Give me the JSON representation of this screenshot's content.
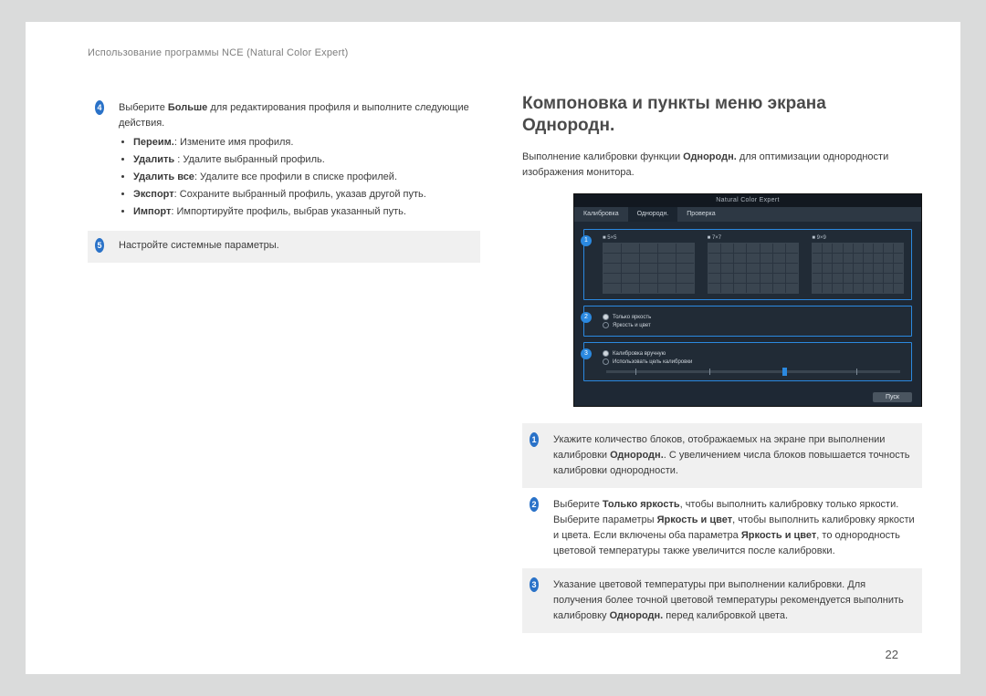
{
  "chapter": "Использование программы NCE (Natural Color Expert)",
  "pageNumber": "22",
  "left": {
    "row4": {
      "num": "4",
      "intro_a": "Выберите ",
      "intro_bold": "Больше",
      "intro_b": " для редактирования профиля и выполните следующие действия.",
      "items": [
        {
          "b": "Переим.",
          "t": ": Измените имя профиля."
        },
        {
          "b": "Удалить ",
          "t": ": Удалите выбранный профиль."
        },
        {
          "b": "Удалить все",
          "t": ": Удалите все профили в списке профилей."
        },
        {
          "b": "Экспорт",
          "t": ": Сохраните выбранный профиль, указав другой путь."
        },
        {
          "b": "Импорт",
          "t": ": Импортируйте профиль, выбрав указанный путь."
        }
      ]
    },
    "row5": {
      "num": "5",
      "text": "Настройте системные параметры."
    }
  },
  "right": {
    "title": "Компоновка и пункты меню экрана Однородн.",
    "lead_a": "Выполнение калибровки функции ",
    "lead_bold": "Однородн.",
    "lead_b": " для оптимизации однородности изображения монитора.",
    "shot": {
      "windowTitle": "Natural Color Expert",
      "tabs": [
        "Калибровка",
        "Однородн.",
        "Проверка"
      ],
      "activeTab": 1,
      "gridLabels": [
        "■ 5×5",
        "■ 7×7",
        "■ 9×9"
      ],
      "radio1": "Только яркость",
      "radio2": "Яркость и цвет",
      "opt3a": "Калибровка вручную",
      "opt3b": "Использовать цель калибровки",
      "button": "Пуск"
    },
    "notes": [
      {
        "num": "1",
        "html": "Укажите количество блоков, отображаемых на экране при выполнении калибровки <b>Однородн.</b>. С увеличением числа блоков повышается точность калибровки однородности."
      },
      {
        "num": "2",
        "html": "Выберите <b>Только яркость</b>, чтобы выполнить калибровку только яркости. Выберите параметры <b>Яркость и цвет</b>, чтобы выполнить калибровку яркости и цвета. Если включены оба параметра <b>Яркость и цвет</b>, то однородность цветовой температуры также увеличится после калибровки."
      },
      {
        "num": "3",
        "html": "Указание цветовой температуры при выполнении калибровки. Для получения более точной цветовой температуры рекомендуется выполнить калибровку <b>Однородн.</b> перед калибровкой цвета."
      }
    ]
  }
}
